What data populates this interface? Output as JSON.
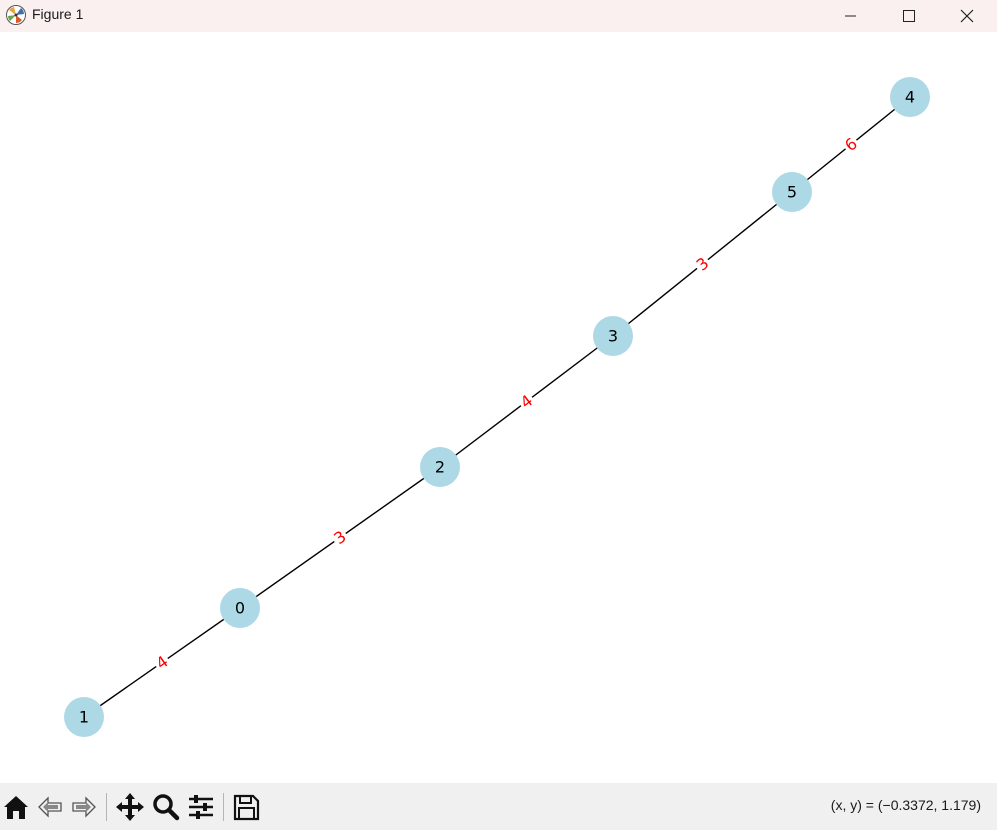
{
  "window": {
    "title": "Figure 1",
    "controls": {
      "minimize": "minimize",
      "maximize": "maximize",
      "close": "close"
    }
  },
  "graph": {
    "node_color": "#add8e6",
    "edge_color": "#000000",
    "edge_label_color": "#ff0000",
    "nodes": [
      {
        "id": "0",
        "label": "0"
      },
      {
        "id": "1",
        "label": "1"
      },
      {
        "id": "2",
        "label": "2"
      },
      {
        "id": "3",
        "label": "3"
      },
      {
        "id": "4",
        "label": "4"
      },
      {
        "id": "5",
        "label": "5"
      }
    ],
    "edges": [
      {
        "source": "1",
        "target": "0",
        "label": "4"
      },
      {
        "source": "0",
        "target": "2",
        "label": "3"
      },
      {
        "source": "2",
        "target": "3",
        "label": "4"
      },
      {
        "source": "3",
        "target": "5",
        "label": "3"
      },
      {
        "source": "5",
        "target": "4",
        "label": "6"
      }
    ]
  },
  "toolbar": {
    "buttons": [
      {
        "name": "home-button",
        "icon": "home-icon"
      },
      {
        "name": "back-button",
        "icon": "back-arrow-icon"
      },
      {
        "name": "forward-button",
        "icon": "forward-arrow-icon"
      },
      {
        "name": "pan-button",
        "icon": "move-icon"
      },
      {
        "name": "zoom-button",
        "icon": "magnifier-icon"
      },
      {
        "name": "configure-subplots-button",
        "icon": "sliders-icon"
      },
      {
        "name": "save-button",
        "icon": "floppy-disk-icon"
      }
    ],
    "coordinates": "(x, y) = (−0.3372, 1.179)"
  }
}
